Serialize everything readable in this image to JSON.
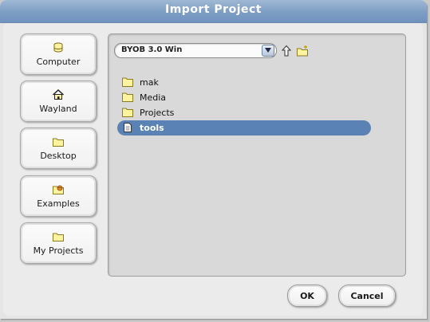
{
  "dialog": {
    "title": "Import Project"
  },
  "sidebar": {
    "items": [
      {
        "label": "Computer",
        "icon": "computer-icon"
      },
      {
        "label": "Wayland",
        "icon": "home-icon"
      },
      {
        "label": "Desktop",
        "icon": "folder-icon"
      },
      {
        "label": "Examples",
        "icon": "examples-folder-icon"
      },
      {
        "label": "My Projects",
        "icon": "folder-icon"
      }
    ]
  },
  "location": {
    "selected": "BYOB 3.0 Win"
  },
  "files": [
    {
      "name": "mak",
      "type": "folder",
      "selected": false
    },
    {
      "name": "Media",
      "type": "folder",
      "selected": false
    },
    {
      "name": "Projects",
      "type": "folder",
      "selected": false
    },
    {
      "name": "tools",
      "type": "file",
      "selected": true
    }
  ],
  "actions": {
    "ok_label": "OK",
    "cancel_label": "Cancel"
  },
  "colors": {
    "title_bar": "#7d9dc3",
    "selection": "#5a82b4",
    "folder": "#fff3a0"
  }
}
